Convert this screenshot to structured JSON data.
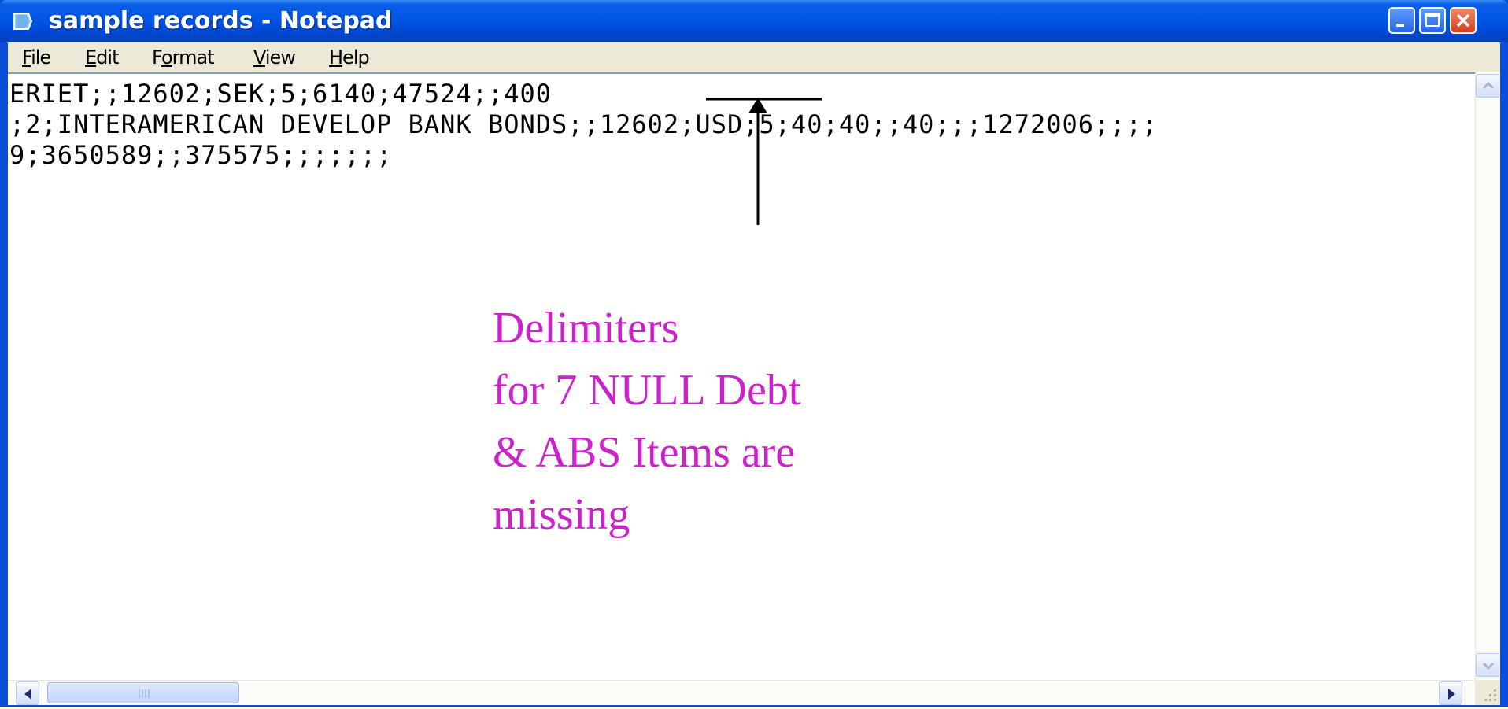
{
  "window": {
    "title": "sample records - Notepad",
    "controls": {
      "minimize": "minimize-icon",
      "maximize": "maximize-icon",
      "close": "close-icon"
    }
  },
  "menu": [
    {
      "label_u": "F",
      "label_rest": "ile"
    },
    {
      "label_u": "E",
      "label_rest": "dit"
    },
    {
      "label_pre": "F",
      "label_u": "o",
      "label_rest": "rmat"
    },
    {
      "label_u": "V",
      "label_rest": "iew"
    },
    {
      "label_u": "H",
      "label_rest": "elp"
    }
  ],
  "editor": {
    "lines": [
      "ERIET;;12602;SEK;5;6140;47524;;400",
      ";2;INTERAMERICAN DEVELOP BANK BONDS;;12602;USD;5;40;40;;40;;;1272006;;;;",
      "9;3650589;;375575;;;;;;;"
    ]
  },
  "annotation": {
    "lines": [
      "Delimiters",
      "for 7 NULL Debt",
      "& ABS Items are",
      "missing"
    ],
    "color": "#cc22cc"
  },
  "colors": {
    "titlebar": "#0055e5",
    "menubar": "#ece9d8",
    "annotation": "#cc22cc"
  }
}
